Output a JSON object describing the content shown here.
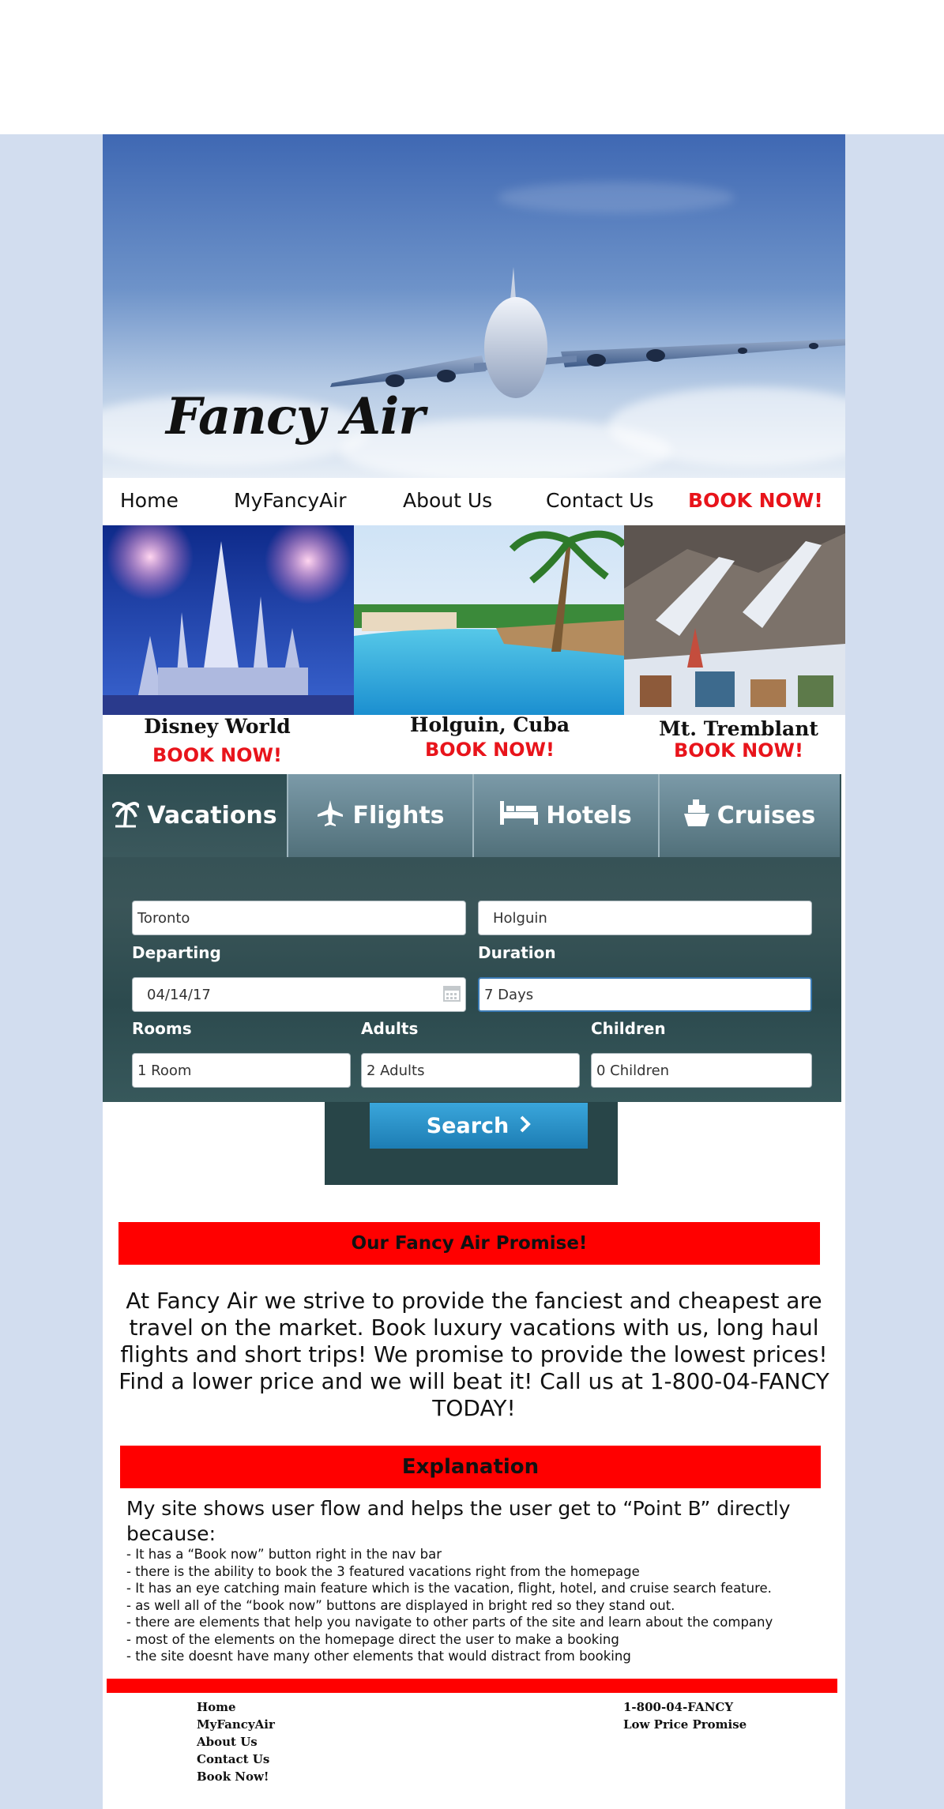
{
  "brand": {
    "name": "Fancy Air"
  },
  "nav": {
    "home": "Home",
    "myfancyair": "MyFancyAir",
    "about": "About Us",
    "contact": "Contact Us",
    "book": "BOOK NOW!"
  },
  "featured": [
    {
      "title": "Disney World",
      "book": "BOOK NOW!"
    },
    {
      "title": "Holguin, Cuba",
      "book": "BOOK NOW!"
    },
    {
      "title": "Mt. Tremblant",
      "book": "BOOK NOW!"
    }
  ],
  "search": {
    "tabs": [
      {
        "label": "Vacations",
        "icon": "palm-tree-icon"
      },
      {
        "label": "Flights",
        "icon": "airplane-icon"
      },
      {
        "label": "Hotels",
        "icon": "bed-icon"
      },
      {
        "label": "Cruises",
        "icon": "cruise-ship-icon"
      }
    ],
    "from_value": "Toronto",
    "to_value": "Holguin",
    "departing_label": "Departing",
    "departing_value": "04/14/17",
    "duration_label": "Duration",
    "duration_value": "7 Days",
    "rooms_label": "Rooms",
    "rooms_value": "1 Room",
    "adults_label": "Adults",
    "adults_value": "2 Adults",
    "children_label": "Children",
    "children_value": "0 Children",
    "button": "Search"
  },
  "promise": {
    "title": "Our Fancy Air Promise!",
    "text": "At Fancy Air we strive to provide the fanciest and cheapest are travel on the market. Book luxury vacations with us, long haul flights and short trips! We promise to provide the lowest prices! Find a lower price and we will beat it! Call us at 1-800-04-FANCY TODAY!"
  },
  "explanation": {
    "title": "Explanation",
    "intro": "My site shows user flow and helps the user get to “Point B” directly because:",
    "points": [
      "- It has a “Book now” button right in the nav bar",
      "- there is the ability to book the 3 featured vacations right from the homepage",
      "- It has an eye catching main feature which is the vacation, flight, hotel, and cruise search feature.",
      "- as well all of the “book now” buttons are displayed in bright red so they stand out.",
      "- there are elements that help you navigate to other parts of the site and learn about the company",
      "- most of the elements on the homepage direct the user to make a booking",
      "- the site doesnt have many other elements that would distract from booking"
    ]
  },
  "footer": {
    "links": [
      "Home",
      "MyFancyAir",
      "About Us",
      "Contact Us",
      "Book Now!"
    ],
    "phone": "1-800-04-FANCY",
    "promise_link": "Low Price Promise"
  },
  "colors": {
    "accent_red": "#e8141b",
    "bar_red": "#ff0000",
    "side_background": "#d2ddef",
    "search_button": "#2a8fc7",
    "widget_dark": "#2f4d52"
  }
}
